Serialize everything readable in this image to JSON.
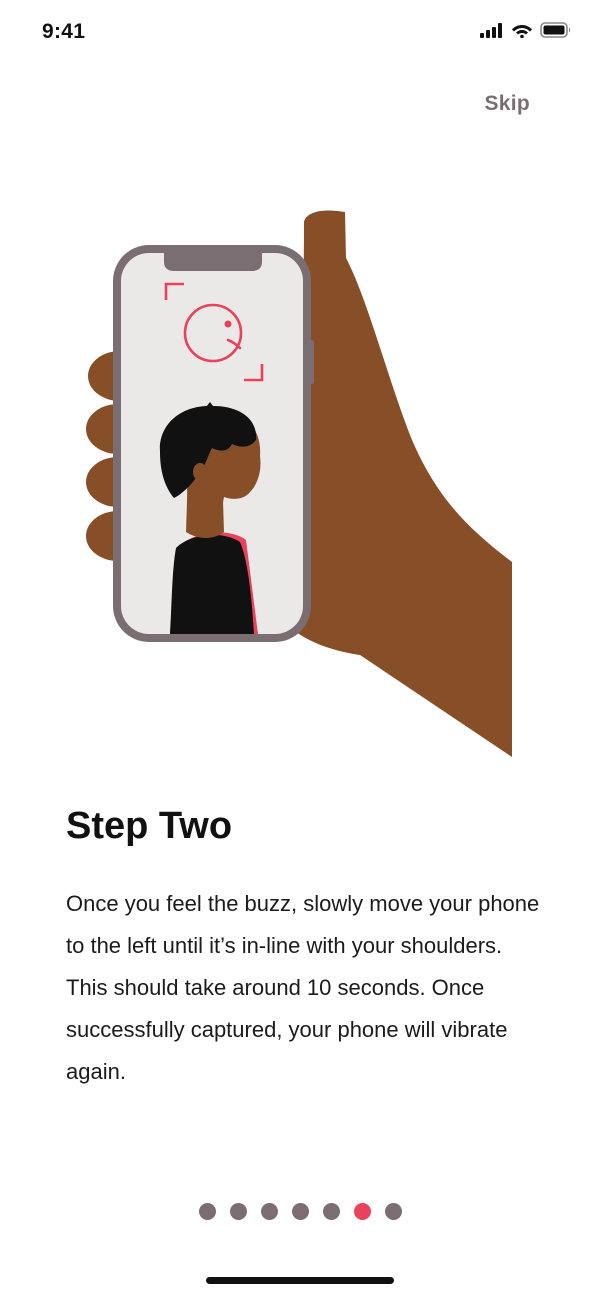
{
  "status_bar": {
    "time": "9:41",
    "icons": [
      "signal-icon",
      "wifi-icon",
      "battery-icon"
    ]
  },
  "header": {
    "skip_label": "Skip"
  },
  "illustration": {
    "icons": [
      "hand-holding-phone",
      "face-scan-icon",
      "person-silhouette"
    ],
    "colors": {
      "skin": "#874f27",
      "phone_frame": "#7b6e72",
      "screen": "#ebe9e8",
      "accent": "#e8425c",
      "hair": "#111111"
    }
  },
  "content": {
    "title": "Step Two",
    "body": "Once you feel the buzz, slowly move your phone to the left until it’s in-line with your shoulders. This should take around 10 seconds. Once successfully captured, your phone will vibrate again."
  },
  "pager": {
    "total": 7,
    "current": 6,
    "dot_color": "#7b6e72",
    "active_color": "#e8425c"
  }
}
